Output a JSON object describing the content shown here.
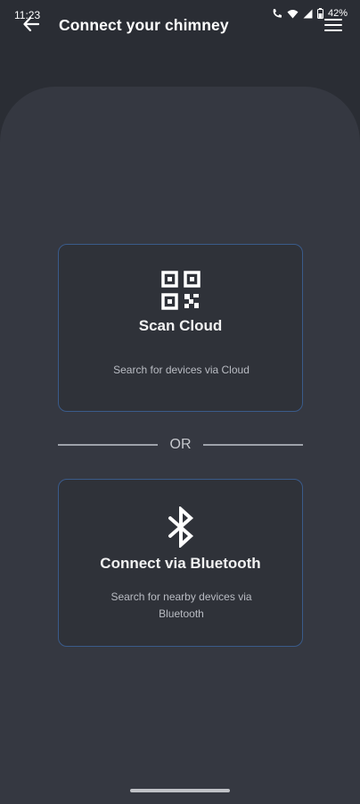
{
  "status_bar": {
    "time": "11:23",
    "battery": "42%",
    "icons": [
      "call-icon",
      "wifi-icon",
      "signal-icon",
      "battery-icon"
    ]
  },
  "header": {
    "title": "Connect your chimney",
    "back_icon": "back-arrow-icon",
    "menu_icon": "hamburger-menu-icon"
  },
  "options": {
    "cloud": {
      "icon": "qr-code-icon",
      "title": "Scan Cloud",
      "description": "Search for devices via Cloud"
    },
    "divider": "OR",
    "bluetooth": {
      "icon": "bluetooth-icon",
      "title": "Connect via Bluetooth",
      "description": "Search for nearby devices via Bluetooth"
    }
  },
  "colors": {
    "background": "#2a2d34",
    "panel": "#353841",
    "card_border": "#3a5b8a",
    "text": "#ffffff",
    "muted_text": "#b9bcc3"
  }
}
